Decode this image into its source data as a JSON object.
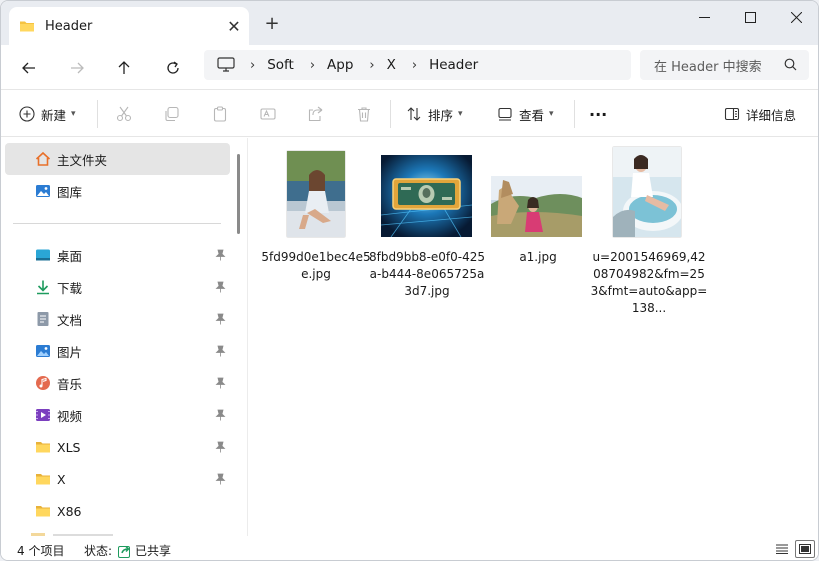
{
  "tab": {
    "title": "Header",
    "close_label": "✕",
    "new_tab_label": "+"
  },
  "breadcrumb": [
    "Soft",
    "App",
    "X",
    "Header"
  ],
  "breadcrumb_separator": "›",
  "search": {
    "placeholder": "在 Header 中搜索"
  },
  "toolbar": {
    "new_label": "新建",
    "sort_label": "排序",
    "view_label": "查看",
    "more_label": "···",
    "details_label": "详细信息"
  },
  "sidebar": {
    "items": [
      {
        "label": "主文件夹",
        "icon": "home-icon",
        "selected": true
      },
      {
        "label": "图库",
        "icon": "gallery-icon"
      },
      {
        "label": "桌面",
        "icon": "desktop-icon",
        "pinned": true
      },
      {
        "label": "下载",
        "icon": "download-icon",
        "pinned": true
      },
      {
        "label": "文档",
        "icon": "document-icon",
        "pinned": true
      },
      {
        "label": "图片",
        "icon": "pictures-icon",
        "pinned": true
      },
      {
        "label": "音乐",
        "icon": "music-icon",
        "pinned": true
      },
      {
        "label": "视频",
        "icon": "video-icon",
        "pinned": true
      },
      {
        "label": "XLS",
        "icon": "folder-icon",
        "pinned": true
      },
      {
        "label": "X",
        "icon": "folder-icon",
        "pinned": true
      },
      {
        "label": "X86",
        "icon": "folder-icon"
      }
    ]
  },
  "files": [
    {
      "name": "5fd99d0e1bec4e5e.jpg"
    },
    {
      "name": "8fbd9bb8-e0f0-425a-b444-8e065725a3d7.jpg"
    },
    {
      "name": "a1.jpg"
    },
    {
      "name": "u=2001546969,4208704982&fm=253&fmt=auto&app=138..."
    }
  ],
  "status": {
    "count": "4 个项目",
    "state_label": "状态:",
    "shared_label": "已共享"
  },
  "colors": {
    "folder": "#f5c342",
    "accent": "#0067c0",
    "selected_bg": "#e5e5e5"
  }
}
